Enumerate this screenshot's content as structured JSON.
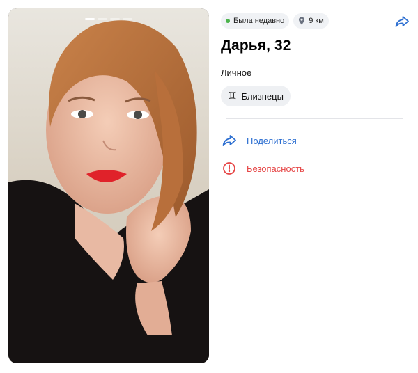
{
  "profile": {
    "status": "Была недавно",
    "distance": "9 км",
    "name_age": "Дарья, 32",
    "section_label": "Личное",
    "zodiac": "Близнецы",
    "zodiac_glyph": "♊"
  },
  "actions": {
    "share": "Поделиться",
    "safety": "Безопасность"
  },
  "photo": {
    "count": 4,
    "active_index": 0
  },
  "colors": {
    "accent": "#2d6fd1",
    "danger": "#e64646",
    "online": "#4bb34b",
    "chip_bg": "#f0f2f5"
  }
}
